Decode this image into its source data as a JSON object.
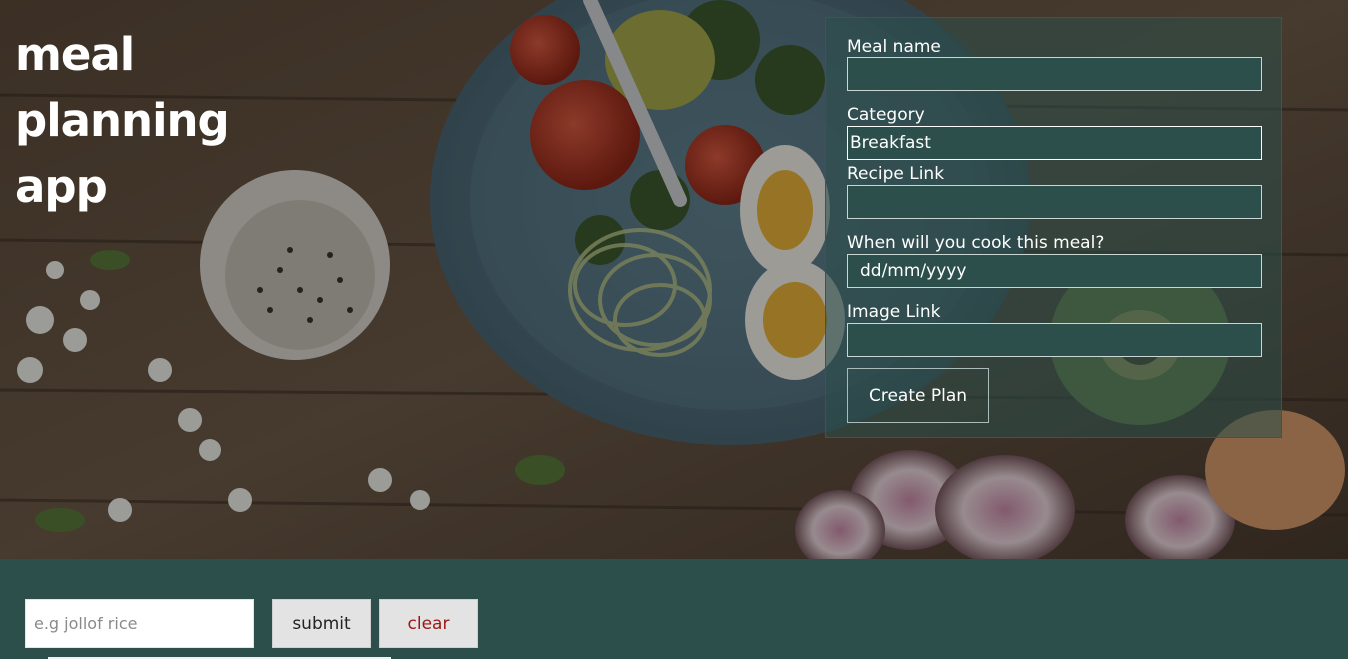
{
  "hero": {
    "title_line1": "meal",
    "title_line2": "planning",
    "title_line3": "app"
  },
  "form": {
    "meal_name_label": "Meal name",
    "meal_name_value": "",
    "category_label": "Category",
    "category_value": "Breakfast",
    "recipe_link_label": "Recipe Link",
    "recipe_link_value": "",
    "cook_date_label": "When will you cook this meal?",
    "cook_date_placeholder": "dd/mm/yyyy",
    "image_link_label": "Image Link",
    "image_link_value": "",
    "create_button_label": "Create Plan"
  },
  "search": {
    "placeholder": "e.g jollof rice",
    "submit_label": "submit",
    "clear_label": "clear"
  },
  "colors": {
    "panel": "#2c4f4b",
    "clear_text": "#9a1616"
  }
}
